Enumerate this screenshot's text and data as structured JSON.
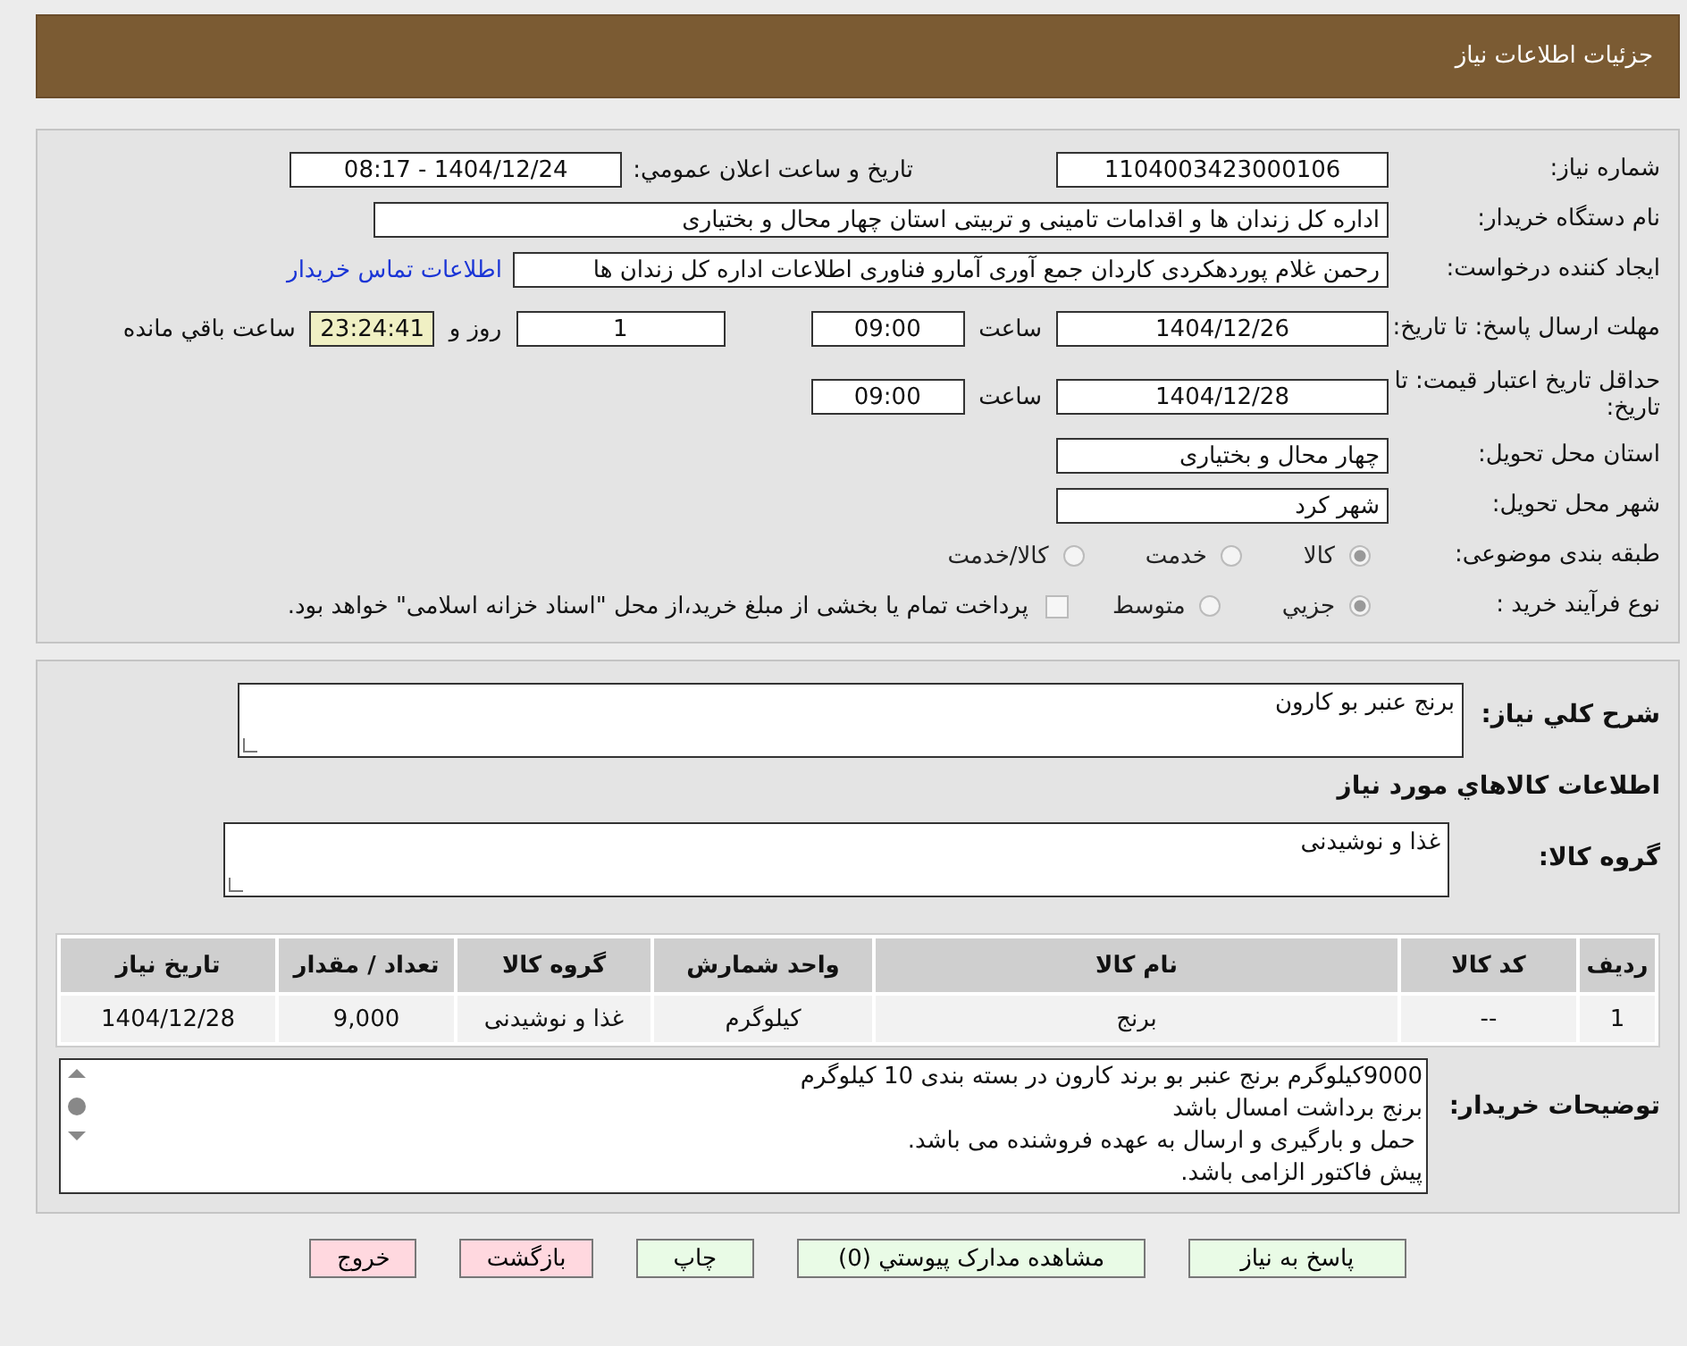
{
  "header": {
    "title": "جزئیات اطلاعات نیاز"
  },
  "need_info": {
    "need_number": {
      "label": "شماره نیاز:",
      "value": "1104003423000106"
    },
    "announce": {
      "label": "تاريخ و ساعت اعلان عمومي:",
      "value": "1404/12/24 - 08:17"
    },
    "buyer": {
      "label": "نام دستگاه خریدار:",
      "value": "اداره کل زندان ها و اقدامات تامینی و تربیتی استان چهار محال و بختیاری"
    },
    "creator": {
      "label": "ایجاد کننده درخواست:",
      "value": "رحمن غلام پوردهکردی کاردان جمع آوری آمارو فناوری اطلاعات اداره کل زندان ها",
      "link": "اطلاعات تماس خریدار"
    },
    "deadline": {
      "label": "مهلت ارسال پاسخ: تا تاریخ:",
      "date": "1404/12/26",
      "time_label": "ساعت",
      "time": "09:00",
      "days": "1",
      "days_label": "روز و",
      "remaining": "23:24:41",
      "remaining_label": "ساعت باقي مانده"
    },
    "validity": {
      "label": "حداقل تاریخ اعتبار قیمت: تا تاریخ:",
      "date": "1404/12/28",
      "time_label": "ساعت",
      "time": "09:00"
    },
    "province": {
      "label": "استان محل تحویل:",
      "value": "چهار محال و بختیاری"
    },
    "city": {
      "label": "شهر محل تحویل:",
      "value": "شهر کرد"
    },
    "category": {
      "label": "طبقه بندی موضوعی:",
      "options": [
        {
          "label": "کالا",
          "selected": true
        },
        {
          "label": "خدمت",
          "selected": false
        },
        {
          "label": "کالا/خدمت",
          "selected": false
        }
      ]
    },
    "process": {
      "label": "نوع فرآیند خرید :",
      "options": [
        {
          "label": "جزيي",
          "selected": true
        },
        {
          "label": "متوسط",
          "selected": false
        }
      ],
      "treasury": {
        "checked": false,
        "label": "پرداخت تمام یا بخشی از مبلغ خرید،از محل \"اسناد خزانه اسلامی\" خواهد بود."
      }
    }
  },
  "goods": {
    "summary": {
      "label": "شرح کلي نیاز:",
      "value": "برنج عنبر بو کارون"
    },
    "section_title": "اطلاعات کالاهاي مورد نیاز",
    "group": {
      "label": "گروه کالا:",
      "value": "غذا و نوشیدنی"
    },
    "table": {
      "columns": [
        "ردیف",
        "کد کالا",
        "نام کالا",
        "واحد شمارش",
        "گروه کالا",
        "تعداد / مقدار",
        "تاریخ نیاز"
      ],
      "rows": [
        [
          "1",
          "--",
          "برنج",
          "کیلوگرم",
          "غذا و نوشیدنی",
          "9,000",
          "1404/12/28"
        ]
      ]
    },
    "notes": {
      "label": "توضیحات خریدار:",
      "lines": [
        "9000کیلوگرم برنج عنبر بو برند کارون در بسته بندی 10 کیلوگرم",
        "برنج برداشت امسال باشد",
        " حمل و بارگیری و ارسال به عهده فروشنده می باشد.",
        "پیش فاکتور الزامی باشد."
      ]
    }
  },
  "buttons": [
    {
      "label": "پاسخ به نیاز",
      "kind": "action"
    },
    {
      "label": "مشاهده مدارک پیوستي (0)",
      "kind": "action"
    },
    {
      "label": "چاپ",
      "kind": "action"
    },
    {
      "label": "بازگشت",
      "kind": "exit"
    },
    {
      "label": "خروج",
      "kind": "exit"
    }
  ]
}
